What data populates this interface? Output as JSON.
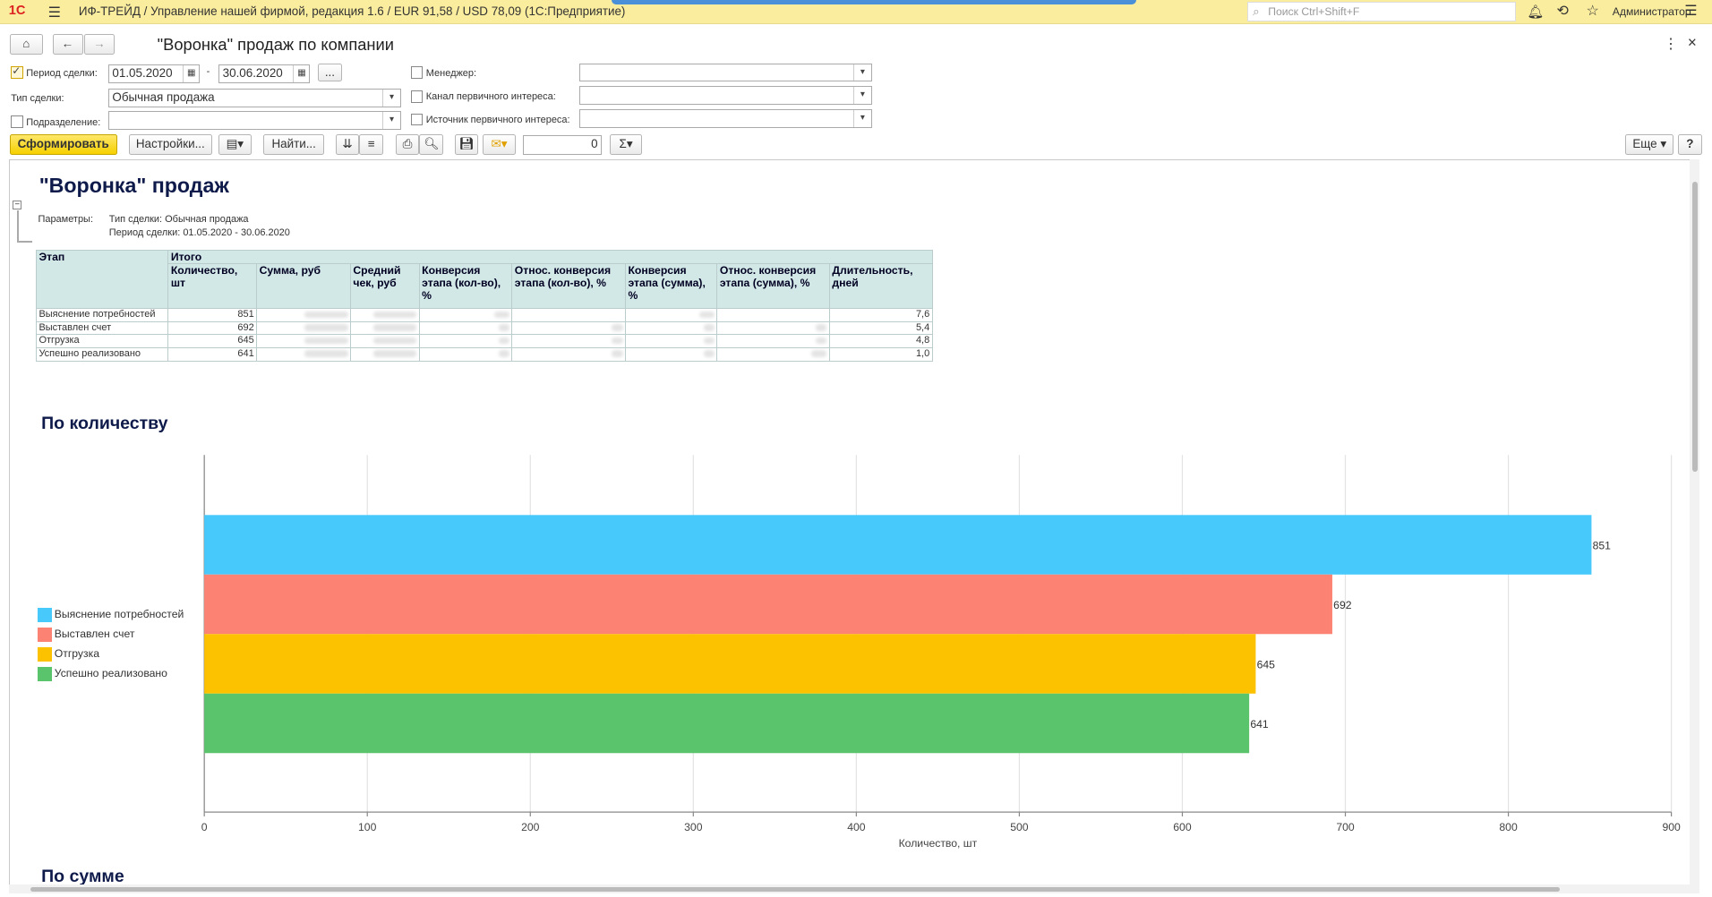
{
  "topbar": {
    "logo": "1С",
    "title": "ИФ-ТРЕЙД / Управление нашей фирмой, редакция 1.6 / EUR 91,58 / USD 78,09  (1С:Предприятие)",
    "search_placeholder": "Поиск Ctrl+Shift+F",
    "user": "Администратор"
  },
  "header": {
    "title": "\"Воронка\" продаж по компании"
  },
  "filters": {
    "period_label": "Период сделки:",
    "period_from": "01.05.2020",
    "period_sep": "-",
    "period_to": "30.06.2020",
    "period_more": "...",
    "deal_type_label": "Тип сделки:",
    "deal_type_value": "Обычная продажа",
    "division_label": "Подразделение:",
    "manager_label": "Менеджер:",
    "channel_label": "Канал первичного интереса:",
    "source_label": "Источник первичного интереса:"
  },
  "toolbar": {
    "generate": "Сформировать",
    "settings": "Настройки...",
    "find": "Найти...",
    "counter": "0",
    "sigma": "Σ",
    "more": "Еще",
    "help": "?"
  },
  "report": {
    "title": "\"Воронка\" продаж",
    "params_label": "Параметры:",
    "param1": "Тип сделки: Обычная продажа",
    "param2": "Период сделки: 01.05.2020 - 30.06.2020",
    "stage_header": "Этап",
    "total_header": "Итого",
    "columns": [
      "Количество, шт",
      "Сумма, руб",
      "Средний чек, руб",
      "Конверсия этапа (кол-во), %",
      "Относ. конверсия этапа (кол-во), %",
      "Конверсия этапа (сумма), %",
      "Относ. конверсия этапа (сумма), %",
      "Длительность, дней"
    ],
    "rows": [
      {
        "stage": "Выяснение потребностей",
        "qty": "851",
        "days": "7,6"
      },
      {
        "stage": "Выставлен счет",
        "qty": "692",
        "days": "5,4"
      },
      {
        "stage": "Отгрузка",
        "qty": "645",
        "days": "4,8"
      },
      {
        "stage": "Успешно реализовано",
        "qty": "641",
        "days": "1,0"
      }
    ],
    "section_qty": "По количеству",
    "section_sum": "По сумме"
  },
  "chart_data": {
    "type": "bar",
    "orientation": "horizontal",
    "categories": [
      "Выяснение потребностей",
      "Выставлен счет",
      "Отгрузка",
      "Успешно реализовано"
    ],
    "values": [
      851,
      692,
      645,
      641
    ],
    "colors": [
      "#48c9fb",
      "#fc8373",
      "#fcc200",
      "#5ac46c"
    ],
    "xlabel": "Количество, шт",
    "xlim": [
      0,
      900
    ],
    "xticks": [
      0,
      100,
      200,
      300,
      400,
      500,
      600,
      700,
      800,
      900
    ],
    "grid": true,
    "legend": "left"
  }
}
